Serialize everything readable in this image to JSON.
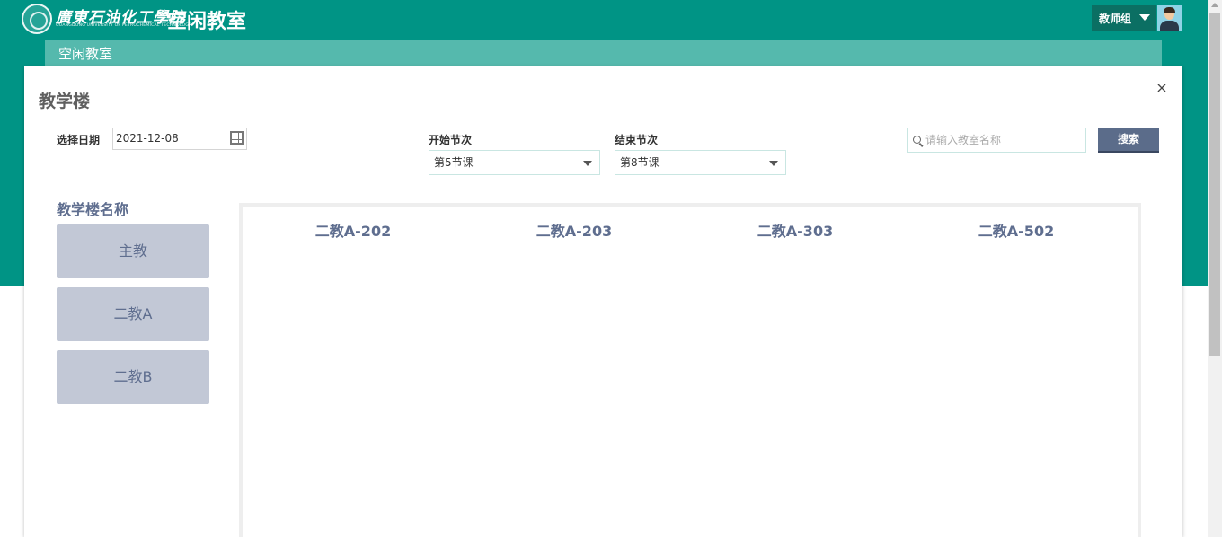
{
  "header": {
    "logo_script": "廣東石油化工學院",
    "logo_sub": "GUANGDONG UNIVERSITY OF PETROCHEMICAL TECHNOLOGY",
    "title": "空闲教室",
    "user": "教师组",
    "colors": {
      "primary": "#009485",
      "subnav": "#55b9ad",
      "user_bg": "#0b6f63"
    }
  },
  "subnav": {
    "label": "空闲教室"
  },
  "panel": {
    "title": "教学楼",
    "close": "×",
    "date_label": "选择日期",
    "date_value": "2021-12-08",
    "start_label": "开始节次",
    "start_value": "第5节课",
    "end_label": "结束节次",
    "end_value": "第8节课",
    "search_placeholder": "请输入教室名称",
    "search_button": "搜索"
  },
  "buildings": {
    "title": "教学楼名称",
    "items": [
      "主教",
      "二教A",
      "二教B"
    ]
  },
  "rooms": [
    "二教A-202",
    "二教A-203",
    "二教A-303",
    "二教A-502"
  ],
  "icons": [
    "logo-emblem",
    "chevron-down-icon",
    "avatar",
    "close-icon",
    "calendar-icon",
    "search-icon"
  ]
}
